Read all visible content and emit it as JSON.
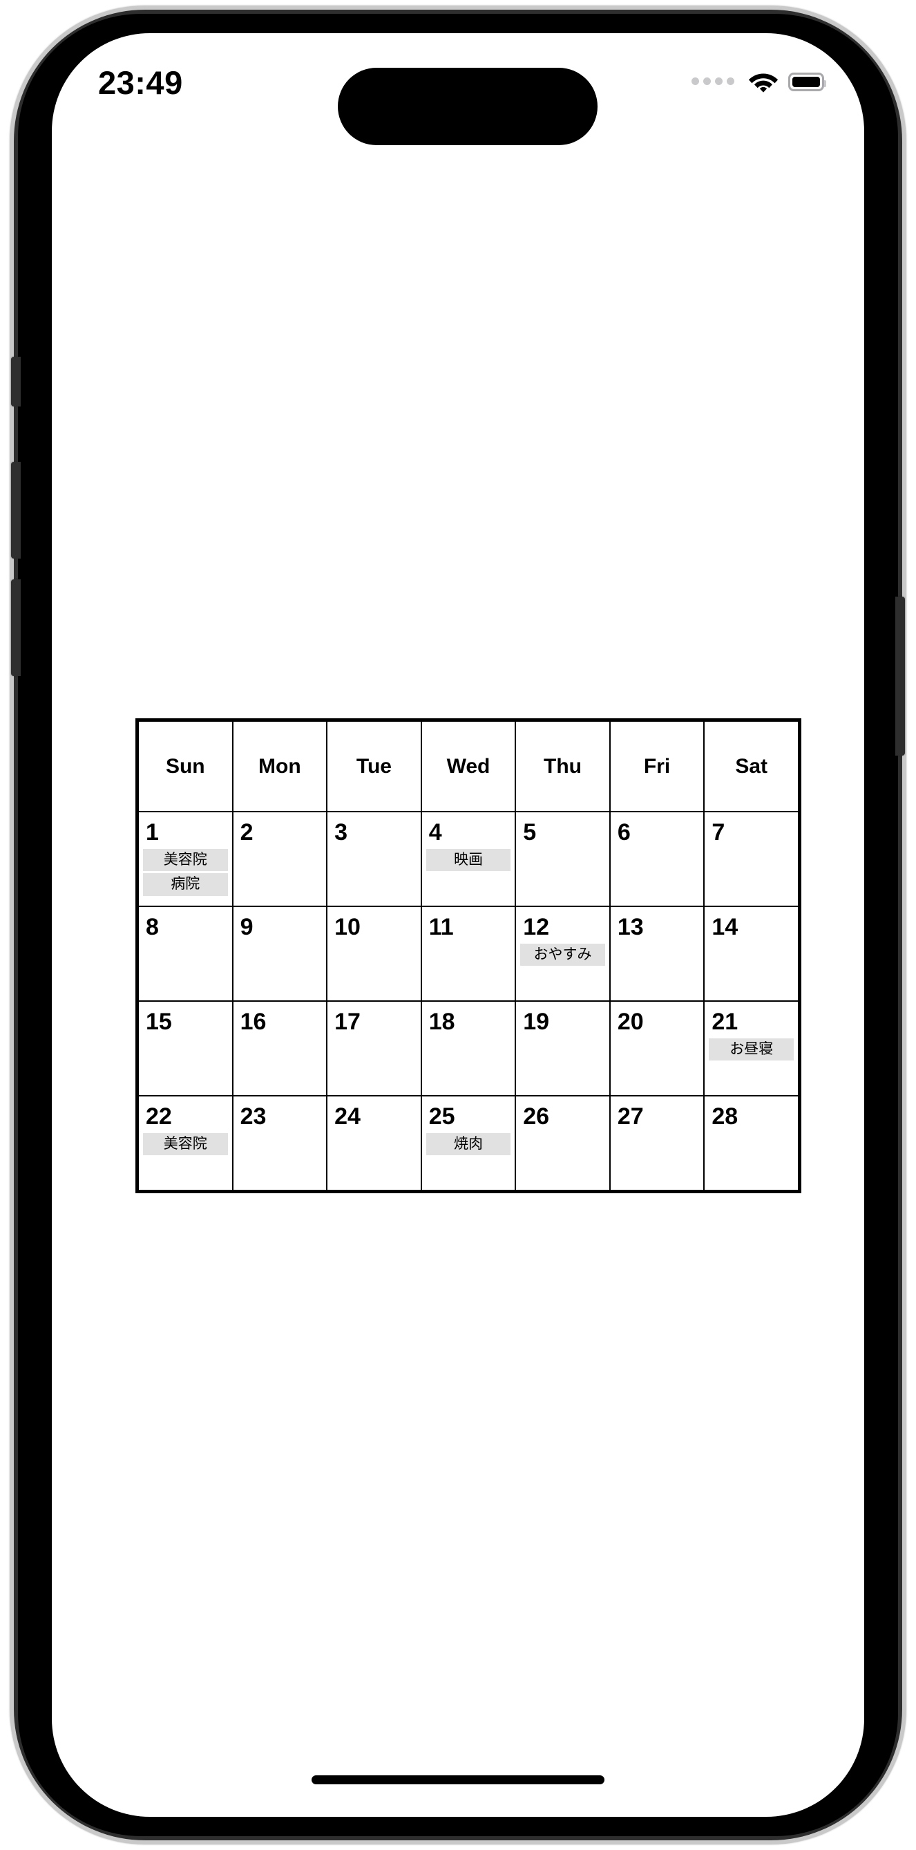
{
  "status_bar": {
    "time": "23:49",
    "signal_icon": "cellular-dots-icon",
    "wifi_icon": "wifi-icon",
    "battery_icon": "battery-icon"
  },
  "calendar": {
    "weekday_headers": [
      "Sun",
      "Mon",
      "Tue",
      "Wed",
      "Thu",
      "Fri",
      "Sat"
    ],
    "colors": {
      "grid_line": "#000000",
      "event_chip_bg": "#e1e1e1",
      "text": "#000000"
    },
    "weeks": [
      [
        {
          "day": "1",
          "events": [
            "美容院",
            "病院"
          ]
        },
        {
          "day": "2",
          "events": []
        },
        {
          "day": "3",
          "events": []
        },
        {
          "day": "4",
          "events": [
            "映画"
          ]
        },
        {
          "day": "5",
          "events": []
        },
        {
          "day": "6",
          "events": []
        },
        {
          "day": "7",
          "events": []
        }
      ],
      [
        {
          "day": "8",
          "events": []
        },
        {
          "day": "9",
          "events": []
        },
        {
          "day": "10",
          "events": []
        },
        {
          "day": "11",
          "events": []
        },
        {
          "day": "12",
          "events": [
            "おやすみ"
          ]
        },
        {
          "day": "13",
          "events": []
        },
        {
          "day": "14",
          "events": []
        }
      ],
      [
        {
          "day": "15",
          "events": []
        },
        {
          "day": "16",
          "events": []
        },
        {
          "day": "17",
          "events": []
        },
        {
          "day": "18",
          "events": []
        },
        {
          "day": "19",
          "events": []
        },
        {
          "day": "20",
          "events": []
        },
        {
          "day": "21",
          "events": [
            "お昼寝"
          ]
        }
      ],
      [
        {
          "day": "22",
          "events": [
            "美容院"
          ]
        },
        {
          "day": "23",
          "events": []
        },
        {
          "day": "24",
          "events": []
        },
        {
          "day": "25",
          "events": [
            "焼肉"
          ]
        },
        {
          "day": "26",
          "events": []
        },
        {
          "day": "27",
          "events": []
        },
        {
          "day": "28",
          "events": []
        }
      ]
    ]
  },
  "home_indicator": {
    "label": "home-indicator"
  }
}
